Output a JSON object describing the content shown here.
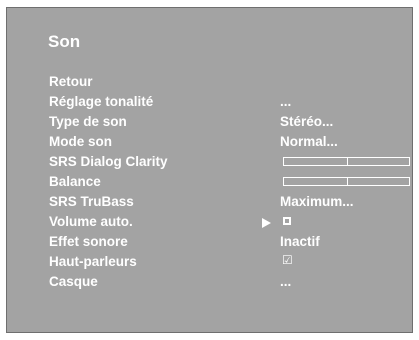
{
  "title": "Son",
  "menu": {
    "items": [
      {
        "label": "Retour"
      },
      {
        "label": "Réglage tonalité",
        "value": "..."
      },
      {
        "label": "Type de son",
        "value": "Stéréo..."
      },
      {
        "label": "Mode son",
        "value": "Normal..."
      },
      {
        "label": "SRS Dialog Clarity",
        "level": 0.5
      },
      {
        "label": "Balance",
        "level": 0.5
      },
      {
        "label": "SRS TruBass",
        "value": "Maximum..."
      },
      {
        "label": "Volume auto.",
        "checked": false
      },
      {
        "label": "Effet sonore",
        "value": "Inactif"
      },
      {
        "label": "Haut-parleurs",
        "checked": true
      },
      {
        "label": "Casque",
        "value": "..."
      }
    ]
  },
  "colors": {
    "background": "#a3a3a3",
    "text": "#ffffff"
  },
  "icons": {
    "pointer": "play-arrow-icon",
    "unchecked": "checkbox-empty-icon",
    "checked": "checkbox-checked-icon"
  }
}
